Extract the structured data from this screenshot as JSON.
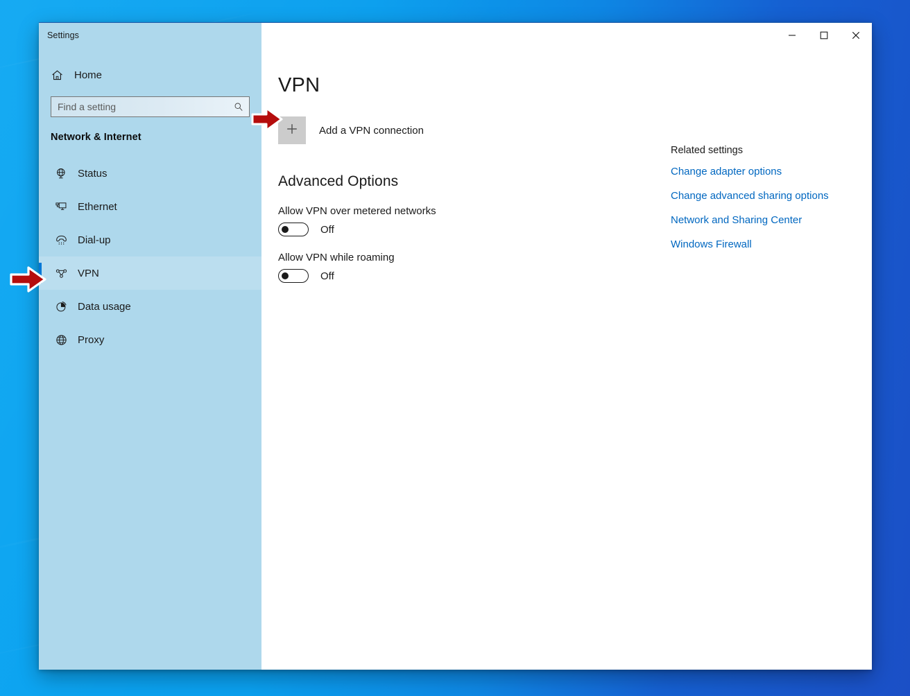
{
  "window": {
    "app_title": "Settings",
    "controls": [
      {
        "name": "minimize",
        "glyph": "minimize-icon",
        "tooltip": "Minimize"
      },
      {
        "name": "maximize",
        "glyph": "maximize-icon",
        "tooltip": "Maximize"
      },
      {
        "name": "close",
        "glyph": "close-icon",
        "tooltip": "Close"
      }
    ]
  },
  "sidebar": {
    "home_label": "Home",
    "home_icon": "home-icon",
    "search": {
      "placeholder": "Find a setting",
      "value": "",
      "icon": "search-icon"
    },
    "category_title": "Network & Internet",
    "items": [
      {
        "label": "Status",
        "icon": "status-globe-icon",
        "selected": false
      },
      {
        "label": "Ethernet",
        "icon": "ethernet-icon",
        "selected": false
      },
      {
        "label": "Dial-up",
        "icon": "dialup-phone-icon",
        "selected": false
      },
      {
        "label": "VPN",
        "icon": "vpn-key-icon",
        "selected": true
      },
      {
        "label": "Data usage",
        "icon": "pie-chart-icon",
        "selected": false
      },
      {
        "label": "Proxy",
        "icon": "globe-icon",
        "selected": false
      }
    ]
  },
  "main": {
    "page_title": "VPN",
    "add_vpn": {
      "icon": "plus-icon",
      "label": "Add a VPN connection"
    },
    "advanced_title": "Advanced Options",
    "settings": [
      {
        "label": "Allow VPN over metered networks",
        "state": "Off",
        "on": false
      },
      {
        "label": "Allow VPN while roaming",
        "state": "Off",
        "on": false
      }
    ]
  },
  "related": {
    "title": "Related settings",
    "links": [
      "Change adapter options",
      "Change advanced sharing options",
      "Network and Sharing Center",
      "Windows Firewall"
    ]
  },
  "annotations": [
    {
      "name": "arrow-pointing-to-vpn-nav-item",
      "color": "#b50d0d"
    },
    {
      "name": "arrow-pointing-to-add-vpn-button",
      "color": "#b50d0d"
    }
  ],
  "colors": {
    "accent": "#0078d7",
    "link": "#0067c0",
    "sidebar_bg": "#aed8ec",
    "annotation_red": "#b50d0d",
    "desktop_blue": "#0aa6f2"
  }
}
